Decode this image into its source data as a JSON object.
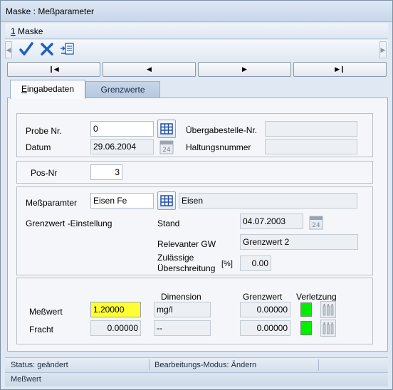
{
  "window": {
    "title": "Maske : Meßparameter"
  },
  "menu": {
    "item_number": "1",
    "item_label": " Maske"
  },
  "toolbar": {
    "icons": [
      "checkmark-icon",
      "close-x-icon",
      "export-icon"
    ],
    "colors": {
      "check": "#1f5fc0",
      "close": "#1f5fc0"
    }
  },
  "navigation": {
    "first": "❙◀",
    "prev": "◀",
    "next": "▶",
    "last": "▶❙"
  },
  "tabs": [
    {
      "label": "Eingabedaten",
      "accel": "E",
      "rest": "ingabedaten",
      "active": true
    },
    {
      "label": "Grenzwerte",
      "active": false
    }
  ],
  "probe": {
    "probe_nr_label": "Probe Nr.",
    "probe_nr_value": "0",
    "datum_label": "Datum",
    "datum_value": "29.06.2004",
    "uebergabestelle_label": "Übergabestelle-Nr.",
    "uebergabestelle_value": "",
    "haltungsnummer_label": "Haltungsnummer",
    "haltungsnummer_value": ""
  },
  "pos": {
    "label": "Pos-Nr",
    "value": "3"
  },
  "messparameter": {
    "label": "Meßparamter",
    "value": "Eisen Fe",
    "name_value": "Eisen",
    "grenzwert_einstellung_label": "Grenzwert -Einstellung",
    "stand_label": "Stand",
    "stand_value": "04.07.2003",
    "relevanter_gw_label": "Relevanter GW",
    "relevanter_gw_value": "Grenzwert 2",
    "zulaessige_label_1": "Zulässige",
    "zulaessige_label_2": "Überschreitung",
    "zulaessige_unit": "[%]",
    "zulaessige_value": "0.00"
  },
  "messwerte": {
    "dimension_header": "Dimension",
    "grenzwert_header": "Grenzwert",
    "verletzung_header": "Verletzung",
    "rows": [
      {
        "label": "Meßwert",
        "value": "1.20000",
        "dimension": "mg/l",
        "grenzwert": "0.00000",
        "status_color": "#00ee00"
      },
      {
        "label": "Fracht",
        "value": "0.00000",
        "dimension": "--",
        "grenzwert": "0.00000",
        "status_color": "#00ee00"
      }
    ]
  },
  "status": {
    "status_text": "Status: geändert",
    "mode_text": "Bearbeitungs-Modus: Ändern",
    "field_text": "Meßwert"
  }
}
